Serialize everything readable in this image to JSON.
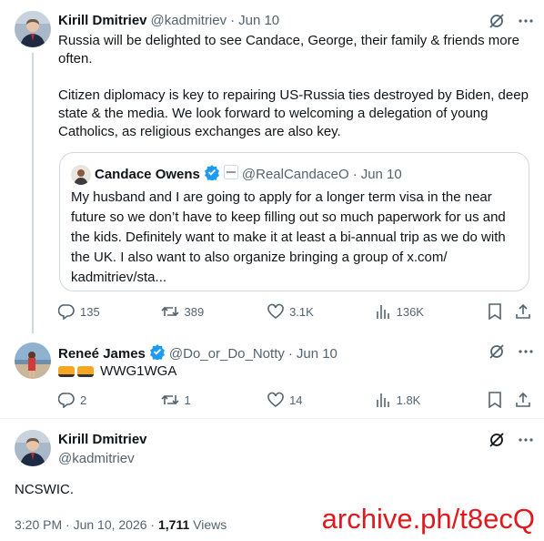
{
  "tweet1": {
    "name": "Kirill Dmitriev",
    "handle": "@kadmitriev",
    "sep": "·",
    "time": "Jun 10",
    "text": "Russia will be delighted to see Candace, George, their family & friends more often.\n\nCitizen diplomacy is key to repairing US-Russia ties destroyed by Biden, deep state & the media. We look forward to welcoming a delegation of young Catholics, as religious exchanges are also key.",
    "quote": {
      "name": "Candace Owens",
      "handle": "@RealCandaceO",
      "sep": "·",
      "time": "Jun 10",
      "text": "My husband and I are going to apply for a longer term visa in the near future so we don’t have to keep filling out so much paperwork for us and the kids. Definitely want to make it at least a bi-annual trip as we do with the UK. I also want to also organize bringing a group of x.com/\nkadmitriev/sta..."
    },
    "stats": {
      "replies": "135",
      "reposts": "389",
      "likes": "3.1K",
      "views": "136K"
    }
  },
  "tweet2": {
    "name": "Reneé James",
    "handle": "@Do_or_Do_Notty",
    "sep": "·",
    "time": "Jun 10",
    "text": "WWG1WGA",
    "stats": {
      "replies": "2",
      "reposts": "1",
      "likes": "14",
      "views": "1.8K"
    }
  },
  "tweet3": {
    "name": "Kirill Dmitriev",
    "handle": "@kadmitriev",
    "text": "NCSWIC.",
    "timestamp": "3:20 PM · Jun 10, 2026 · ",
    "views_count": "1,711",
    "views_label": " Views"
  },
  "watermark": "archive.ph/t8ecQ",
  "colors": {
    "verified": "#1d9bf0",
    "watermark": "#e0191f",
    "muted": "#536471"
  },
  "icons": [
    "grok-icon",
    "more-icon",
    "reply-icon",
    "repost-icon",
    "like-icon",
    "views-icon",
    "bookmark-icon",
    "share-icon",
    "verified-icon"
  ]
}
